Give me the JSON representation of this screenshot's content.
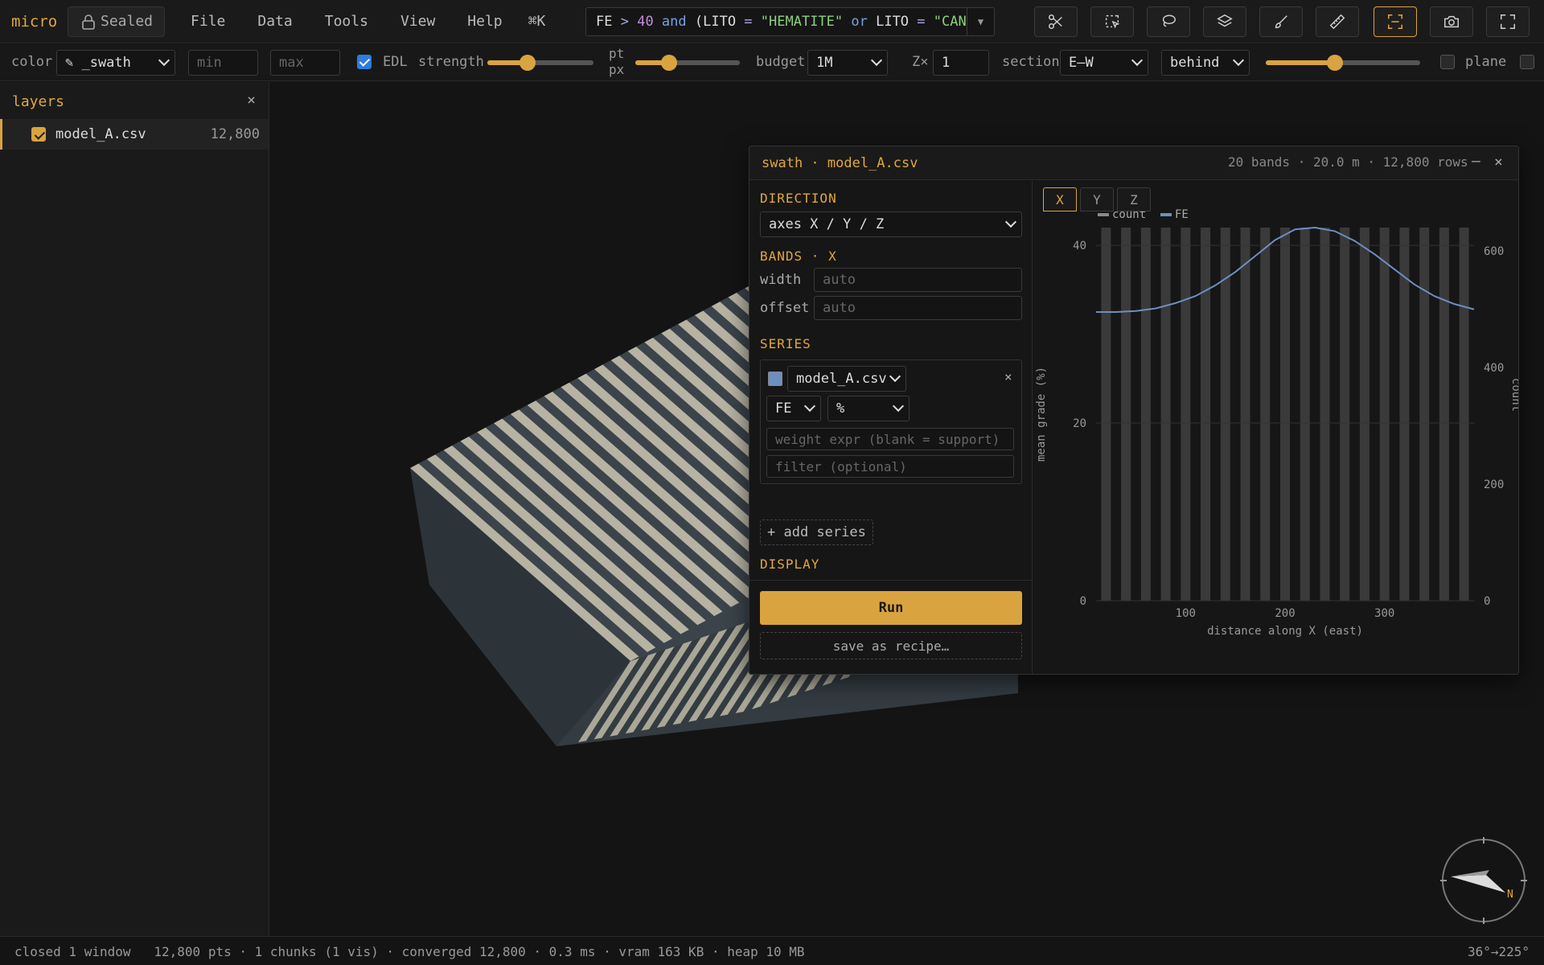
{
  "app": {
    "logo": "micro",
    "sealed_label": "Sealed",
    "shortcut": "⌘K"
  },
  "menu": [
    "File",
    "Data",
    "Tools",
    "View",
    "Help"
  ],
  "query": {
    "parts": [
      {
        "t": "FE ",
        "c": ""
      },
      {
        "t": ">",
        "c": "q-op"
      },
      {
        "t": " 40 ",
        "c": "q-num"
      },
      {
        "t": "and",
        "c": "q-kw"
      },
      {
        "t": " (LITO ",
        "c": ""
      },
      {
        "t": "=",
        "c": "q-op"
      },
      {
        "t": " \"HEMATITE\" ",
        "c": "q-str"
      },
      {
        "t": "or",
        "c": "q-kw"
      },
      {
        "t": " LITO ",
        "c": ""
      },
      {
        "t": "=",
        "c": "q-op"
      },
      {
        "t": " \"CANGA\")",
        "c": "q-str"
      }
    ]
  },
  "toolbar_icons": [
    "scissors-icon",
    "box-select-icon",
    "lasso-icon",
    "layers-icon",
    "brush-icon",
    "ruler-icon",
    "swath-frame-icon",
    "camera-icon",
    "fullscreen-icon"
  ],
  "controls": {
    "color_label": "color",
    "color_value": "✎ _swath",
    "min_placeholder": "min",
    "max_placeholder": "max",
    "edl_label": "EDL",
    "edl_on": true,
    "strength_label": "strength",
    "strength_value": 0.38,
    "pt_label": "pt",
    "px_label": "px",
    "pt_value": 0.32,
    "budget_label": "budget",
    "budget_value": "1M",
    "z_label": "Z×",
    "z_value": "1",
    "section_label": "section",
    "section_value": "E–W",
    "behind_value": "behind",
    "section_slider": 0.45,
    "plane_label": "plane"
  },
  "layers": {
    "title": "layers",
    "close": "×",
    "items": [
      {
        "name": "model_A.csv",
        "count": "12,800",
        "checked": true
      }
    ]
  },
  "panel": {
    "title": "swath · model_A.csv",
    "meta": "20 bands · 20.0 m · 12,800 rows",
    "min": "–",
    "close": "×",
    "direction_label": "DIRECTION",
    "direction_value": "axes X / Y / Z",
    "bands_label": "BANDS · X",
    "width_label": "width",
    "width_placeholder": "auto",
    "offset_label": "offset",
    "offset_placeholder": "auto",
    "series_label": "SERIES",
    "series": {
      "file": "model_A.csv",
      "var": "FE",
      "unit": "%",
      "weight_placeholder": "weight expr (blank = support)",
      "filter_placeholder": "filter (optional)",
      "color": "#6d8fbf"
    },
    "add_series": "+ add series",
    "display_label": "DISPLAY",
    "run_label": "Run",
    "save_label": "save as recipe…",
    "tabs": [
      "X",
      "Y",
      "Z"
    ]
  },
  "chart_data": {
    "type": "line",
    "legend": [
      {
        "name": "count",
        "color": "#8a8a8a"
      },
      {
        "name": "FE",
        "color": "#6d8fbf"
      }
    ],
    "xlabel": "distance along X (east)",
    "ylabel": "mean grade (%)",
    "y2label": "count",
    "xticks": [
      100,
      200,
      300
    ],
    "yticks": [
      0,
      20,
      40
    ],
    "y2ticks": [
      0,
      200,
      400,
      600
    ],
    "xlim": [
      10,
      390
    ],
    "ylim": [
      0,
      42
    ],
    "y2lim": [
      0,
      640
    ],
    "count_bands": {
      "x": [
        20,
        40,
        60,
        80,
        100,
        120,
        140,
        160,
        180,
        200,
        220,
        240,
        260,
        280,
        300,
        320,
        340,
        360,
        380
      ],
      "values": [
        640,
        640,
        640,
        640,
        640,
        640,
        640,
        640,
        640,
        640,
        640,
        640,
        640,
        640,
        640,
        640,
        640,
        640,
        640
      ]
    },
    "series": [
      {
        "name": "FE",
        "x": [
          10,
          30,
          50,
          70,
          90,
          110,
          130,
          150,
          170,
          190,
          210,
          230,
          250,
          270,
          290,
          310,
          330,
          350,
          370,
          390
        ],
        "values": [
          32.5,
          32.5,
          32.6,
          32.9,
          33.5,
          34.3,
          35.5,
          37.0,
          38.8,
          40.6,
          41.8,
          42.0,
          41.6,
          40.5,
          39.0,
          37.3,
          35.6,
          34.3,
          33.4,
          32.8
        ]
      }
    ]
  },
  "status": {
    "left": "closed 1 window   12,800 pts · 1 chunks (1 vis) · converged 12,800 · 0.3 ms · vram 163 KB · heap 10 MB",
    "right": "36°→225°",
    "compass_label": "N"
  }
}
